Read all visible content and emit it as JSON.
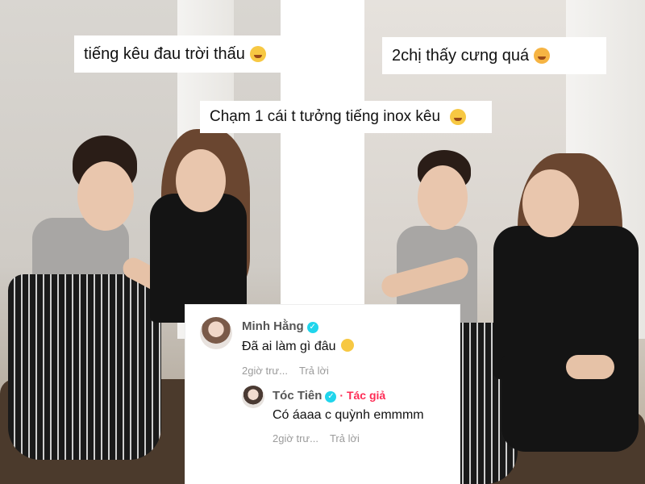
{
  "captions": {
    "left_top": "tiếng kêu đau trời thấu",
    "right_top": "2chị thấy cưng quá",
    "center": "Chạm 1 cái t tưởng tiếng inox kêu"
  },
  "emoji_names": {
    "left_top": "rolling-laughing-emoji",
    "right_top": "smiling-hearts-emoji",
    "center": "hand-over-mouth-emoji"
  },
  "comments": [
    {
      "user": "Minh Hằng",
      "verified": true,
      "text": "Đã ai làm gì đâu",
      "emoji": "eye-roll-emoji",
      "time": "2giờ trư...",
      "reply": "Trả lời"
    },
    {
      "user": "Tóc Tiên",
      "verified": true,
      "author_badge": "· Tác giả",
      "text": "Có áaaa c quỳnh emmmm",
      "time": "2giờ trư...",
      "reply": "Trả lời"
    }
  ],
  "colors": {
    "verified": "#20d5ec",
    "author": "#fe2c55",
    "meta": "#9b9b9b"
  }
}
